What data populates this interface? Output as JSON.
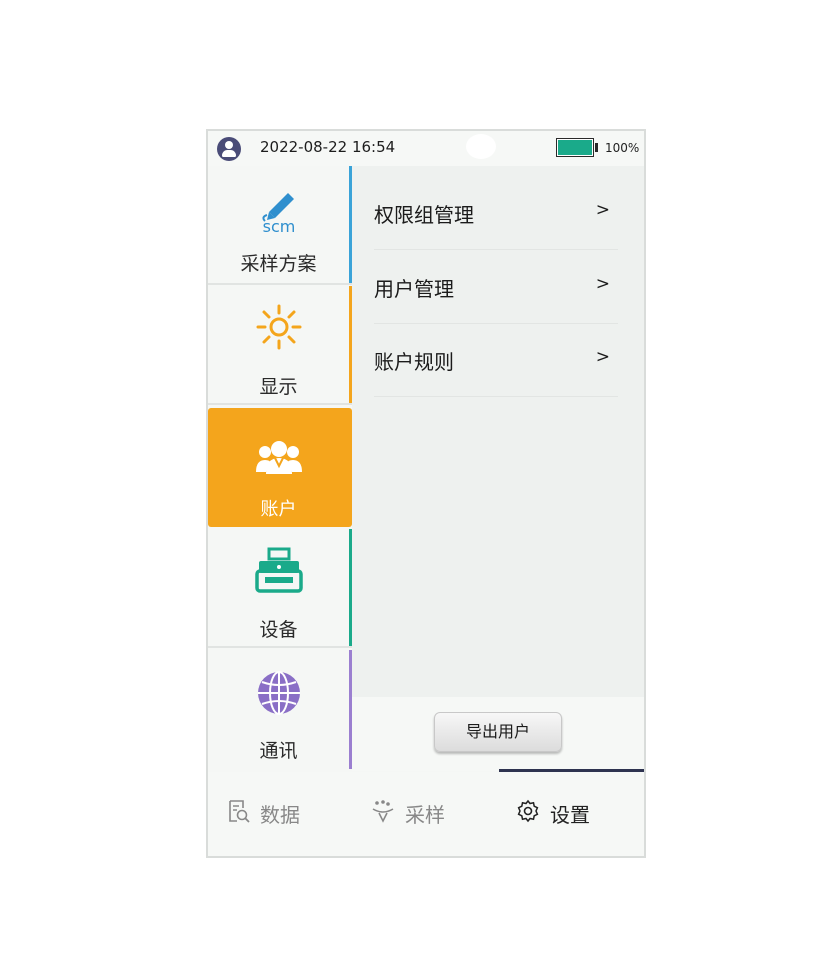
{
  "status_bar": {
    "datetime": "2022-08-22 16:54",
    "battery_percent": "100%",
    "battery_level": 1.0,
    "battery_color": "#1aaa8a"
  },
  "sidebar": {
    "items": [
      {
        "label": "采样方案",
        "icon": "sampling-plan-pen-icon",
        "icon_text": "scm",
        "accent": "#3aa3d8",
        "active": false
      },
      {
        "label": "显示",
        "icon": "sun-icon",
        "accent": "#f4a51c",
        "active": false
      },
      {
        "label": "账户",
        "icon": "users-icon",
        "accent": "#f4a51c",
        "active": true
      },
      {
        "label": "设备",
        "icon": "device-printer-icon",
        "accent": "#1aaa8a",
        "active": false
      },
      {
        "label": "通讯",
        "icon": "globe-icon",
        "accent": "#9b7fd0",
        "active": false
      }
    ]
  },
  "menu": {
    "items": [
      {
        "label": "权限组管理",
        "arrow": ">"
      },
      {
        "label": "用户管理",
        "arrow": ">"
      },
      {
        "label": "账户规则",
        "arrow": ">"
      }
    ]
  },
  "export_button": {
    "label": "导出用户"
  },
  "tabs": [
    {
      "label": "数据",
      "icon": "data-search-icon",
      "active": false
    },
    {
      "label": "采样",
      "icon": "sampling-icon",
      "active": false
    },
    {
      "label": "设置",
      "icon": "settings-gear-icon",
      "active": true
    }
  ],
  "colors": {
    "active_orange": "#f4a51c",
    "tab_indicator": "#2e3350",
    "inactive_tab_text": "#888888",
    "active_tab_text": "#222222"
  }
}
